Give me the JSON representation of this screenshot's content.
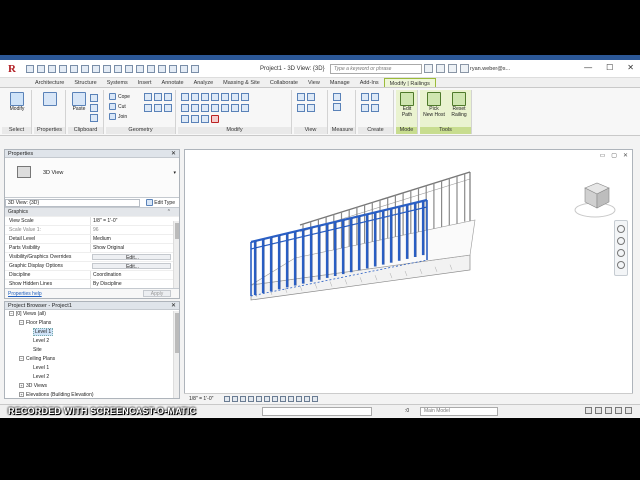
{
  "app": {
    "title": "Project1 - 3D View: {3D}",
    "logo_letter": "R",
    "search_placeholder": "Type a keyword or phrase",
    "user": "ryan.weber@s...",
    "win_controls": [
      "—",
      "☐",
      "✕"
    ]
  },
  "tabs": [
    {
      "label": "Architecture",
      "active": false
    },
    {
      "label": "Structure",
      "active": false
    },
    {
      "label": "Systems",
      "active": false
    },
    {
      "label": "Insert",
      "active": false
    },
    {
      "label": "Annotate",
      "active": false
    },
    {
      "label": "Analyze",
      "active": false
    },
    {
      "label": "Massing & Site",
      "active": false
    },
    {
      "label": "Collaborate",
      "active": false
    },
    {
      "label": "View",
      "active": false
    },
    {
      "label": "Manage",
      "active": false
    },
    {
      "label": "Add-Ins",
      "active": false
    },
    {
      "label": "Modify | Railings",
      "active": true
    }
  ],
  "ribbon": {
    "modify_label": "Modify",
    "select_label": "Select",
    "paste_label": "Paste",
    "cope_label": "Cope",
    "cut_label": "Cut",
    "join_label": "Join",
    "panels": {
      "select": "Select",
      "properties": "Properties",
      "clipboard": "Clipboard",
      "geometry": "Geometry",
      "modify": "Modify",
      "view": "View",
      "measure": "Measure",
      "create": "Create",
      "mode": "Mode",
      "tools": "Tools"
    },
    "edit_path": [
      "Edit",
      "Path"
    ],
    "pick_new_host": [
      "Pick",
      "New Host"
    ],
    "reset_railing": [
      "Reset",
      "Railing"
    ]
  },
  "properties": {
    "title": "Properties",
    "close": "✕",
    "type_name": "3D View",
    "view_selector": "3D View: {3D}",
    "edit_type": "Edit Type",
    "group_graphics": "Graphics",
    "rows": [
      {
        "key": "View Scale",
        "value": "1/8\" = 1'-0\"",
        "button": false,
        "dim": false
      },
      {
        "key": "Scale Value    1:",
        "value": "96",
        "button": false,
        "dim": true
      },
      {
        "key": "Detail Level",
        "value": "Medium",
        "button": false,
        "dim": false
      },
      {
        "key": "Parts Visibility",
        "value": "Show Original",
        "button": false,
        "dim": false
      },
      {
        "key": "Visibility/Graphics Overrides",
        "value": "Edit...",
        "button": true,
        "dim": false
      },
      {
        "key": "Graphic Display Options",
        "value": "Edit...",
        "button": true,
        "dim": false
      },
      {
        "key": "Discipline",
        "value": "Coordination",
        "button": false,
        "dim": false
      },
      {
        "key": "Show Hidden Lines",
        "value": "By Discipline",
        "button": false,
        "dim": false
      }
    ],
    "help_link": "Properties help",
    "apply": "Apply"
  },
  "browser": {
    "title": "Project Browser - Project1",
    "close": "✕",
    "nodes": [
      {
        "label": "[0] Views (all)",
        "toggle": "−",
        "selected": false
      },
      {
        "label": "Floor Plans",
        "toggle": "−",
        "selected": false
      },
      {
        "label": "Level 1",
        "toggle": "",
        "selected": true
      },
      {
        "label": "Level 2",
        "toggle": "",
        "selected": false
      },
      {
        "label": "Site",
        "toggle": "",
        "selected": false
      },
      {
        "label": "Ceiling Plans",
        "toggle": "−",
        "selected": false
      },
      {
        "label": "Level 1",
        "toggle": "",
        "selected": false
      },
      {
        "label": "Level 2",
        "toggle": "",
        "selected": false
      },
      {
        "label": "3D Views",
        "toggle": "+",
        "selected": false
      },
      {
        "label": "Elevations (Building Elevation)",
        "toggle": "+",
        "selected": false
      }
    ]
  },
  "viewport": {
    "controls": [
      "▭",
      "▢",
      "✕"
    ],
    "scale": "1/8\" = 1'-0\"",
    "accent_color": "#2a5fc4"
  },
  "statusbar": {
    "watermark": "RECORDED WITH SCREENCAST-O-MATIC",
    "zero": ":0",
    "model": "Main Model"
  }
}
